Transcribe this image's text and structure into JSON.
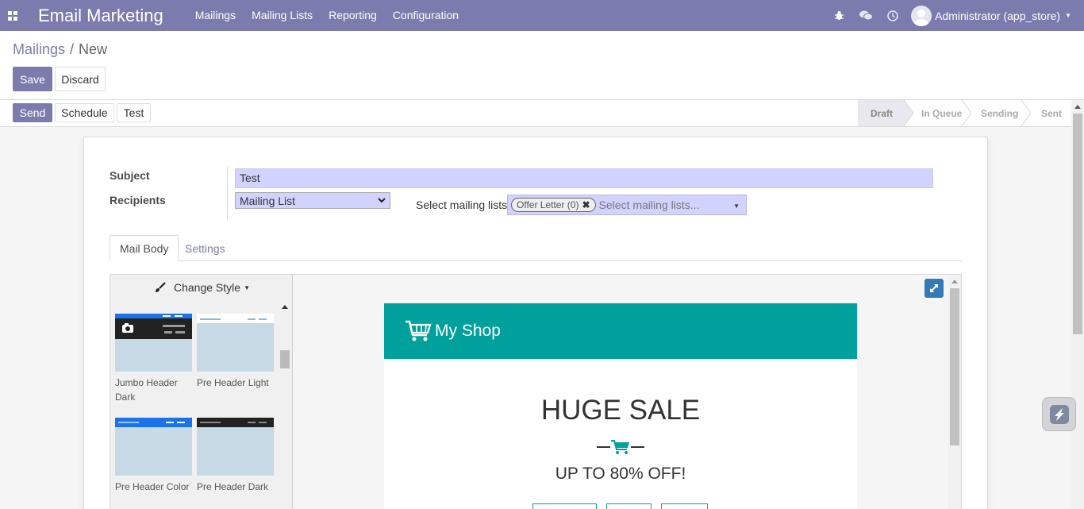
{
  "navbar": {
    "brand": "Email Marketing",
    "menu": [
      "Mailings",
      "Mailing Lists",
      "Reporting",
      "Configuration"
    ],
    "user": "Administrator (app_store)"
  },
  "breadcrumb": {
    "parent": "Mailings",
    "separator": "/",
    "current": "New"
  },
  "buttons": {
    "save": "Save",
    "discard": "Discard",
    "send": "Send",
    "schedule": "Schedule",
    "test": "Test"
  },
  "statusbar": {
    "stages": [
      "Draft",
      "In Queue",
      "Sending",
      "Sent"
    ],
    "active": "Draft"
  },
  "form": {
    "subject_label": "Subject",
    "subject_value": "Test",
    "recipients_label": "Recipients",
    "recipients_value": "Mailing List",
    "select_lists_label": "Select mailing lists:",
    "tag": "Offer Letter (0)",
    "lists_placeholder": "Select mailing lists..."
  },
  "tabs": {
    "mail_body": "Mail Body",
    "settings": "Settings"
  },
  "editor": {
    "change_style": "Change Style",
    "snippets": [
      "Jumbo Header Dark",
      "Pre Header Light",
      "Pre Header Color",
      "Pre Header Dark"
    ]
  },
  "email": {
    "shop_name": "My Shop",
    "headline": "HUGE SALE",
    "subline": "UP TO 80% OFF!"
  },
  "colors": {
    "brand": "#7c7bad",
    "teal": "#00a09d",
    "field": "#d2d2ff"
  }
}
